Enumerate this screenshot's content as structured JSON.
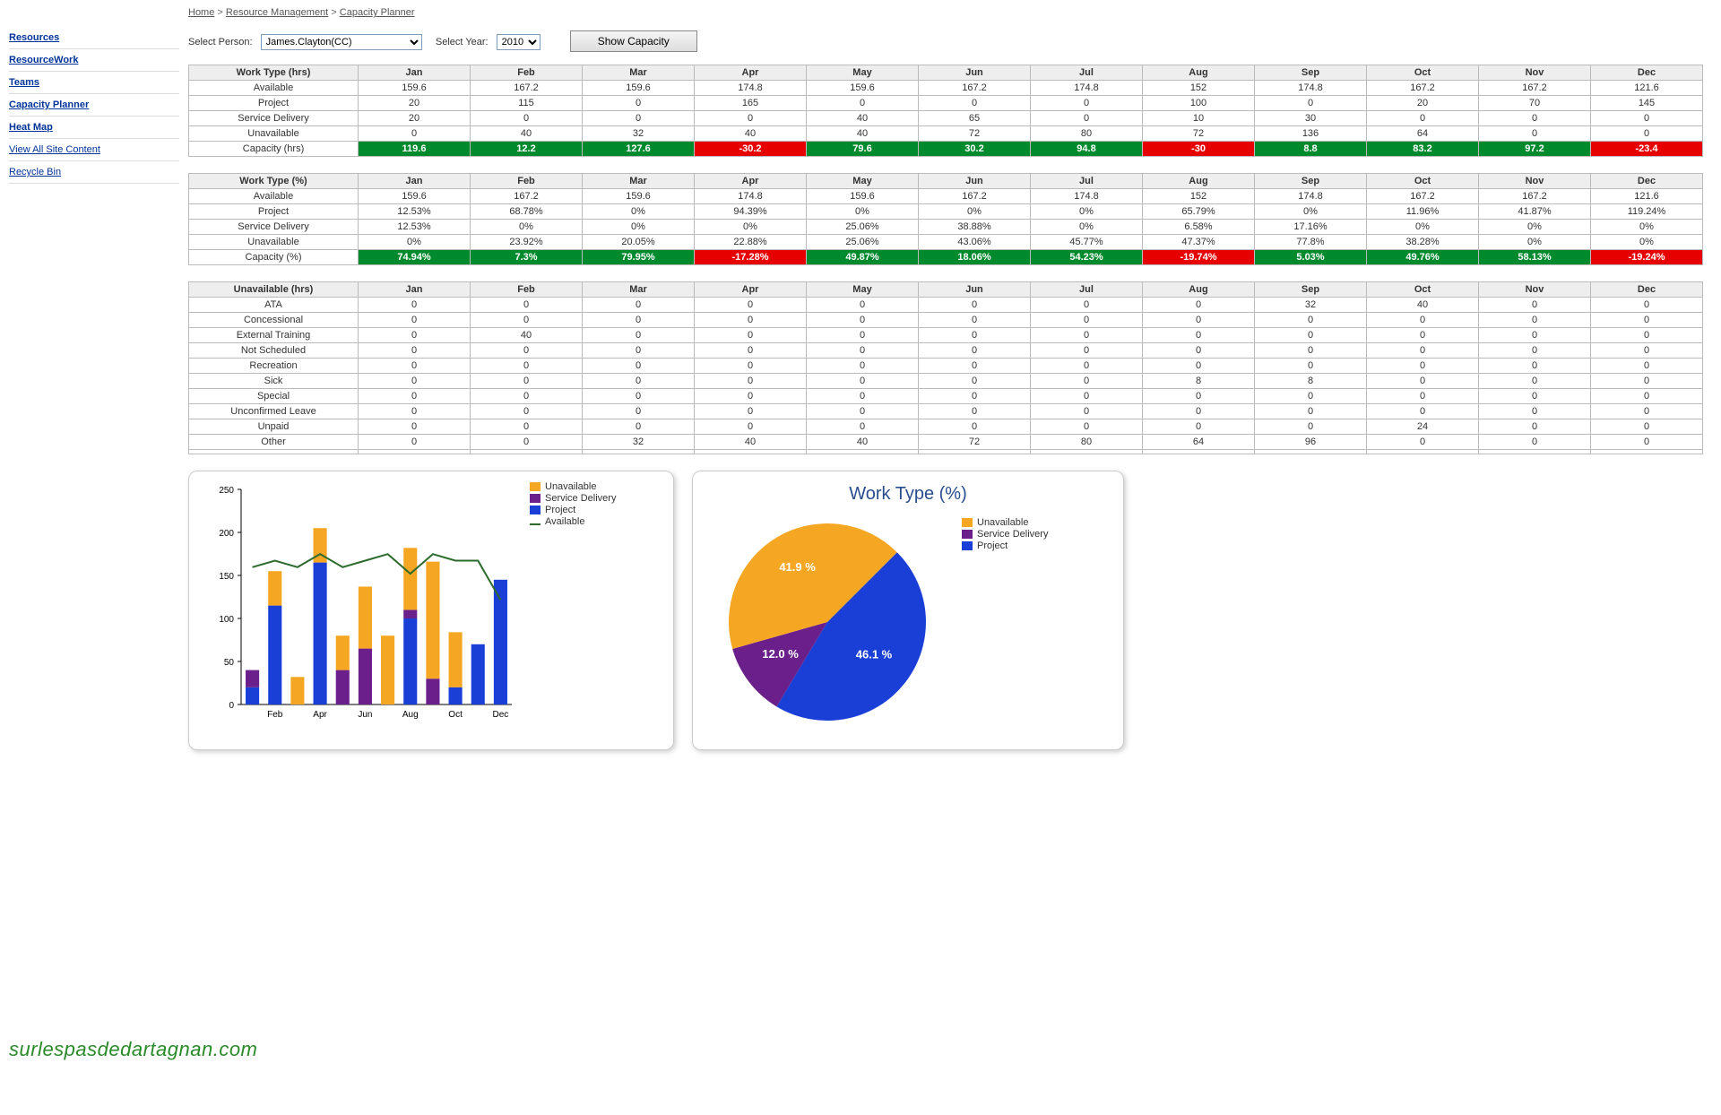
{
  "breadcrumb": {
    "home": "Home",
    "rm": "Resource Management",
    "cp": "Capacity Planner"
  },
  "sidebar": {
    "items": [
      "Resources",
      "ResourceWork",
      "Teams",
      "Capacity Planner",
      "Heat Map",
      "View All Site Content",
      "Recycle Bin"
    ]
  },
  "controls": {
    "selectPerson": "Select Person:",
    "person": "James.Clayton(CC)",
    "selectYear": "Select Year:",
    "year": "2010",
    "show": "Show Capacity"
  },
  "months": [
    "Jan",
    "Feb",
    "Mar",
    "Apr",
    "May",
    "Jun",
    "Jul",
    "Aug",
    "Sep",
    "Oct",
    "Nov",
    "Dec"
  ],
  "table1": {
    "header": "Work Type (hrs)",
    "rows": [
      {
        "label": "Available",
        "v": [
          "159.6",
          "167.2",
          "159.6",
          "174.8",
          "159.6",
          "167.2",
          "174.8",
          "152",
          "174.8",
          "167.2",
          "167.2",
          "121.6"
        ]
      },
      {
        "label": "Project",
        "v": [
          "20",
          "115",
          "0",
          "165",
          "0",
          "0",
          "0",
          "100",
          "0",
          "20",
          "70",
          "145"
        ]
      },
      {
        "label": "Service Delivery",
        "v": [
          "20",
          "0",
          "0",
          "0",
          "40",
          "65",
          "0",
          "10",
          "30",
          "0",
          "0",
          "0"
        ]
      },
      {
        "label": "Unavailable",
        "v": [
          "0",
          "40",
          "32",
          "40",
          "40",
          "72",
          "80",
          "72",
          "136",
          "64",
          "0",
          "0"
        ]
      },
      {
        "label": "Capacity (hrs)",
        "v": [
          "119.6",
          "12.2",
          "127.6",
          "-30.2",
          "79.6",
          "30.2",
          "94.8",
          "-30",
          "8.8",
          "83.2",
          "97.2",
          "-23.4"
        ],
        "cls": [
          "green",
          "green",
          "green",
          "red",
          "green",
          "green",
          "green",
          "red",
          "green",
          "green",
          "green",
          "red"
        ]
      }
    ]
  },
  "table2": {
    "header": "Work Type (%)",
    "rows": [
      {
        "label": "Available",
        "v": [
          "159.6",
          "167.2",
          "159.6",
          "174.8",
          "159.6",
          "167.2",
          "174.8",
          "152",
          "174.8",
          "167.2",
          "167.2",
          "121.6"
        ]
      },
      {
        "label": "Project",
        "v": [
          "12.53%",
          "68.78%",
          "0%",
          "94.39%",
          "0%",
          "0%",
          "0%",
          "65.79%",
          "0%",
          "11.96%",
          "41.87%",
          "119.24%"
        ]
      },
      {
        "label": "Service Delivery",
        "v": [
          "12.53%",
          "0%",
          "0%",
          "0%",
          "25.06%",
          "38.88%",
          "0%",
          "6.58%",
          "17.16%",
          "0%",
          "0%",
          "0%"
        ]
      },
      {
        "label": "Unavailable",
        "v": [
          "0%",
          "23.92%",
          "20.05%",
          "22.88%",
          "25.06%",
          "43.06%",
          "45.77%",
          "47.37%",
          "77.8%",
          "38.28%",
          "0%",
          "0%"
        ]
      },
      {
        "label": "Capacity (%)",
        "v": [
          "74.94%",
          "7.3%",
          "79.95%",
          "-17.28%",
          "49.87%",
          "18.06%",
          "54.23%",
          "-19.74%",
          "5.03%",
          "49.76%",
          "58.13%",
          "-19.24%"
        ],
        "cls": [
          "green",
          "green",
          "green",
          "red",
          "green",
          "green",
          "green",
          "red",
          "green",
          "green",
          "green",
          "red"
        ]
      }
    ]
  },
  "table3": {
    "header": "Unavailable (hrs)",
    "rows": [
      {
        "label": "ATA",
        "v": [
          "0",
          "0",
          "0",
          "0",
          "0",
          "0",
          "0",
          "0",
          "32",
          "40",
          "0",
          "0"
        ]
      },
      {
        "label": "Concessional",
        "v": [
          "0",
          "0",
          "0",
          "0",
          "0",
          "0",
          "0",
          "0",
          "0",
          "0",
          "0",
          "0"
        ]
      },
      {
        "label": "External Training",
        "v": [
          "0",
          "40",
          "0",
          "0",
          "0",
          "0",
          "0",
          "0",
          "0",
          "0",
          "0",
          "0"
        ]
      },
      {
        "label": "Not Scheduled",
        "v": [
          "0",
          "0",
          "0",
          "0",
          "0",
          "0",
          "0",
          "0",
          "0",
          "0",
          "0",
          "0"
        ]
      },
      {
        "label": "Recreation",
        "v": [
          "0",
          "0",
          "0",
          "0",
          "0",
          "0",
          "0",
          "0",
          "0",
          "0",
          "0",
          "0"
        ]
      },
      {
        "label": "Sick",
        "v": [
          "0",
          "0",
          "0",
          "0",
          "0",
          "0",
          "0",
          "8",
          "8",
          "0",
          "0",
          "0"
        ]
      },
      {
        "label": "Special",
        "v": [
          "0",
          "0",
          "0",
          "0",
          "0",
          "0",
          "0",
          "0",
          "0",
          "0",
          "0",
          "0"
        ]
      },
      {
        "label": "Unconfirmed Leave",
        "v": [
          "0",
          "0",
          "0",
          "0",
          "0",
          "0",
          "0",
          "0",
          "0",
          "0",
          "0",
          "0"
        ]
      },
      {
        "label": "Unpaid",
        "v": [
          "0",
          "0",
          "0",
          "0",
          "0",
          "0",
          "0",
          "0",
          "0",
          "24",
          "0",
          "0"
        ]
      },
      {
        "label": "Other",
        "v": [
          "0",
          "0",
          "32",
          "40",
          "40",
          "72",
          "80",
          "64",
          "96",
          "0",
          "0",
          "0"
        ]
      },
      {
        "label": "",
        "v": [
          "",
          "",
          "",
          "",
          "",
          "",
          "",
          "",
          "",
          "",
          "",
          ""
        ]
      }
    ]
  },
  "legend": {
    "un": "Unavailable",
    "sd": "Service Delivery",
    "pr": "Project",
    "av": "Available"
  },
  "pieTitle": "Work Type (%)",
  "chart_data": [
    {
      "type": "bar",
      "stacked": true,
      "categories": [
        "Jan",
        "Feb",
        "Mar",
        "Apr",
        "May",
        "Jun",
        "Jul",
        "Aug",
        "Sep",
        "Oct",
        "Nov",
        "Dec"
      ],
      "series": [
        {
          "name": "Project",
          "color": "#1a3fd6",
          "values": [
            20,
            115,
            0,
            165,
            0,
            0,
            0,
            100,
            0,
            20,
            70,
            145
          ]
        },
        {
          "name": "Service Delivery",
          "color": "#6b1f8a",
          "values": [
            20,
            0,
            0,
            0,
            40,
            65,
            0,
            10,
            30,
            0,
            0,
            0
          ]
        },
        {
          "name": "Unavailable",
          "color": "#f5a623",
          "values": [
            0,
            40,
            32,
            40,
            40,
            72,
            80,
            72,
            136,
            64,
            0,
            0
          ]
        }
      ],
      "line": {
        "name": "Available",
        "color": "#2c6b2c",
        "values": [
          159.6,
          167.2,
          159.6,
          174.8,
          159.6,
          167.2,
          174.8,
          152,
          174.8,
          167.2,
          167.2,
          121.6
        ]
      },
      "ylim": [
        0,
        250
      ],
      "yticks": [
        0,
        50,
        100,
        150,
        200,
        250
      ]
    },
    {
      "type": "pie",
      "title": "Work Type (%)",
      "slices": [
        {
          "name": "Project",
          "color": "#1a3fd6",
          "value": 46.1,
          "label": "46.1 %"
        },
        {
          "name": "Service Delivery",
          "color": "#6b1f8a",
          "value": 12.0,
          "label": "12.0 %"
        },
        {
          "name": "Unavailable",
          "color": "#f5a623",
          "value": 41.9,
          "label": "41.9 %"
        }
      ]
    }
  ],
  "watermark": "surlespasdedartagnan.com"
}
